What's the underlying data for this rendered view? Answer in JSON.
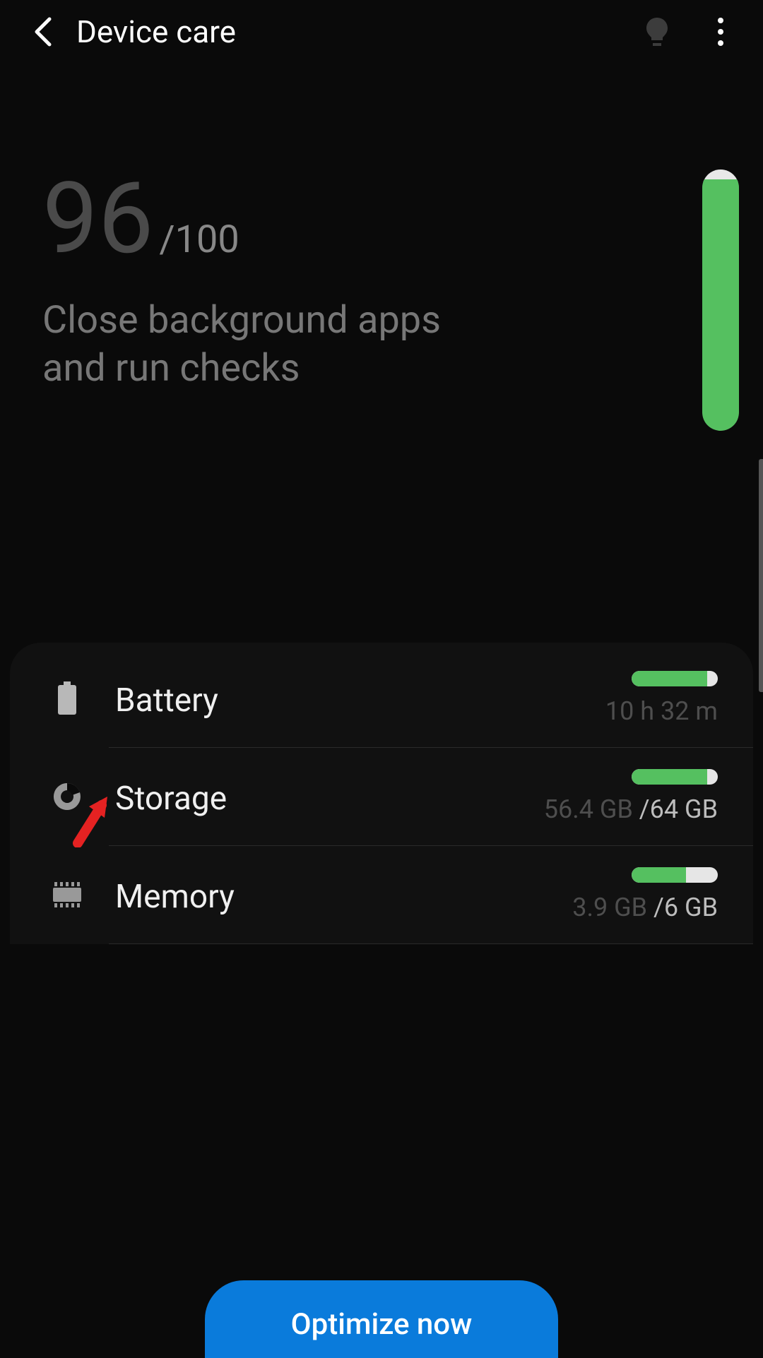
{
  "header": {
    "title": "Device care"
  },
  "score": {
    "value": "96",
    "max": "/100",
    "advice": "Close background apps and run checks",
    "fill_percent": 96
  },
  "rows": {
    "battery": {
      "label": "Battery",
      "sub": "10 h 32 m",
      "fill_percent": 88
    },
    "storage": {
      "label": "Storage",
      "used": "56.4 GB ",
      "total": "/64 GB",
      "fill_percent": 88
    },
    "memory": {
      "label": "Memory",
      "used": "3.9 GB ",
      "total": "/6 GB",
      "fill_percent": 63
    }
  },
  "optimize_label": "Optimize now"
}
